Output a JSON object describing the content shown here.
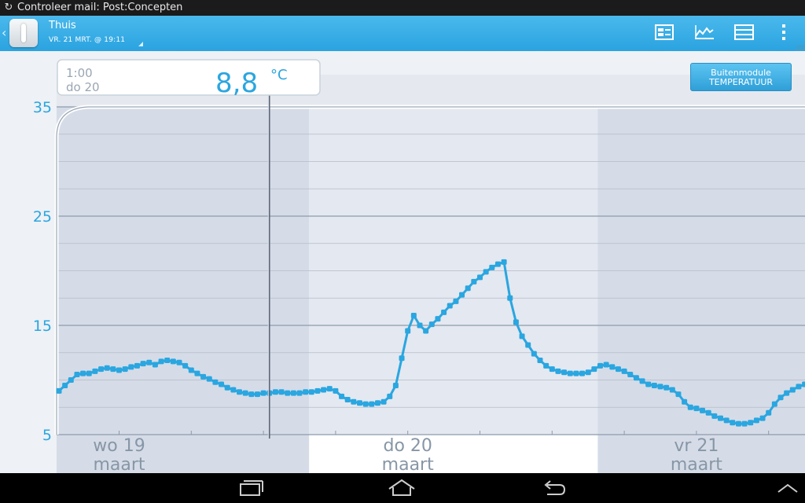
{
  "status_bar": {
    "notification": "Controleer mail: Post:Concepten"
  },
  "action_bar": {
    "location": "Thuis",
    "datetime": "VR. 21 MRT. @ 19:11",
    "icons": [
      "dashboard-icon",
      "graph-icon",
      "list-icon",
      "overflow-menu-icon"
    ]
  },
  "sensor_button": {
    "line1": "Buitenmodule",
    "line2": "TEMPERATUUR"
  },
  "readout": {
    "time": "1:00",
    "day": "do 20",
    "value": "8,8",
    "unit": "°C"
  },
  "colors": {
    "accent": "#2aa6e0",
    "line": "#2aa6e0",
    "shade": "#d5dce7",
    "plot": "#e4e8f0"
  },
  "chart_data": {
    "type": "line",
    "title": "",
    "xlabel": "",
    "ylabel": "",
    "ylim": [
      5,
      35
    ],
    "yticks": [
      5,
      15,
      25,
      35
    ],
    "x_range_hours": [
      0,
      68
    ],
    "day_labels": [
      {
        "day": "wo 19",
        "month": "maart",
        "hour": 5
      },
      {
        "day": "do 20",
        "month": "maart",
        "hour": 29
      },
      {
        "day": "vr 21",
        "month": "maart",
        "hour": 53
      }
    ],
    "cursor_hour": 17.5,
    "series": [
      {
        "points": [
          [
            0,
            9.0
          ],
          [
            0.5,
            9.5
          ],
          [
            1,
            10.0
          ],
          [
            1.5,
            10.5
          ],
          [
            2,
            10.6
          ],
          [
            2.5,
            10.6
          ],
          [
            3,
            10.8
          ],
          [
            3.5,
            11.0
          ],
          [
            4,
            11.1
          ],
          [
            4.5,
            11.0
          ],
          [
            5,
            10.9
          ],
          [
            5.5,
            11.0
          ],
          [
            6,
            11.2
          ],
          [
            6.5,
            11.3
          ],
          [
            7,
            11.5
          ],
          [
            7.5,
            11.6
          ],
          [
            8,
            11.4
          ],
          [
            8.5,
            11.7
          ],
          [
            9,
            11.8
          ],
          [
            9.5,
            11.7
          ],
          [
            10,
            11.6
          ],
          [
            10.5,
            11.3
          ],
          [
            11,
            10.9
          ],
          [
            11.5,
            10.6
          ],
          [
            12,
            10.3
          ],
          [
            12.5,
            10.1
          ],
          [
            13,
            9.8
          ],
          [
            13.5,
            9.6
          ],
          [
            14,
            9.3
          ],
          [
            14.5,
            9.1
          ],
          [
            15,
            8.9
          ],
          [
            15.5,
            8.8
          ],
          [
            16,
            8.7
          ],
          [
            16.5,
            8.7
          ],
          [
            17,
            8.8
          ],
          [
            17.5,
            8.8
          ],
          [
            18,
            8.9
          ],
          [
            18.5,
            8.9
          ],
          [
            19,
            8.8
          ],
          [
            19.5,
            8.8
          ],
          [
            20,
            8.8
          ],
          [
            20.5,
            8.9
          ],
          [
            21,
            8.9
          ],
          [
            21.5,
            9.0
          ],
          [
            22,
            9.1
          ],
          [
            22.5,
            9.2
          ],
          [
            23,
            9.0
          ],
          [
            23.5,
            8.5
          ],
          [
            24,
            8.2
          ],
          [
            24.5,
            8.0
          ],
          [
            25,
            7.9
          ],
          [
            25.5,
            7.8
          ],
          [
            26,
            7.8
          ],
          [
            26.5,
            7.9
          ],
          [
            27,
            8.0
          ],
          [
            27.5,
            8.5
          ],
          [
            28,
            9.5
          ],
          [
            28.5,
            12.0
          ],
          [
            29,
            14.5
          ],
          [
            29.5,
            15.9
          ],
          [
            30,
            15.0
          ],
          [
            30.5,
            14.5
          ],
          [
            31,
            15.1
          ],
          [
            31.5,
            15.6
          ],
          [
            32,
            16.2
          ],
          [
            32.5,
            16.8
          ],
          [
            33,
            17.2
          ],
          [
            33.5,
            17.8
          ],
          [
            34,
            18.4
          ],
          [
            34.5,
            19.0
          ],
          [
            35,
            19.4
          ],
          [
            35.5,
            19.9
          ],
          [
            36,
            20.3
          ],
          [
            36.5,
            20.6
          ],
          [
            37,
            20.8
          ],
          [
            37.5,
            17.5
          ],
          [
            38,
            15.3
          ],
          [
            38.5,
            14.0
          ],
          [
            39,
            13.2
          ],
          [
            39.5,
            12.4
          ],
          [
            40,
            11.8
          ],
          [
            40.5,
            11.3
          ],
          [
            41,
            11.0
          ],
          [
            41.5,
            10.8
          ],
          [
            42,
            10.7
          ],
          [
            42.5,
            10.6
          ],
          [
            43,
            10.6
          ],
          [
            43.5,
            10.6
          ],
          [
            44,
            10.7
          ],
          [
            44.5,
            11.0
          ],
          [
            45,
            11.3
          ],
          [
            45.5,
            11.4
          ],
          [
            46,
            11.2
          ],
          [
            46.5,
            11.0
          ],
          [
            47,
            10.8
          ],
          [
            47.5,
            10.5
          ],
          [
            48,
            10.2
          ],
          [
            48.5,
            9.9
          ],
          [
            49,
            9.6
          ],
          [
            49.5,
            9.5
          ],
          [
            50,
            9.4
          ],
          [
            50.5,
            9.3
          ],
          [
            51,
            9.1
          ],
          [
            51.5,
            8.7
          ],
          [
            52,
            8.0
          ],
          [
            52.5,
            7.5
          ],
          [
            53,
            7.4
          ],
          [
            53.5,
            7.2
          ],
          [
            54,
            7.0
          ],
          [
            54.5,
            6.7
          ],
          [
            55,
            6.5
          ],
          [
            55.5,
            6.3
          ],
          [
            56,
            6.1
          ],
          [
            56.5,
            6.0
          ],
          [
            57,
            6.0
          ],
          [
            57.5,
            6.1
          ],
          [
            58,
            6.3
          ],
          [
            58.5,
            6.5
          ],
          [
            59,
            7.0
          ],
          [
            59.5,
            7.8
          ],
          [
            60,
            8.4
          ],
          [
            60.5,
            8.8
          ],
          [
            61,
            9.1
          ],
          [
            61.5,
            9.4
          ],
          [
            62,
            9.6
          ],
          [
            62.5,
            9.7
          ],
          [
            63,
            9.7
          ],
          [
            63.5,
            9.6
          ],
          [
            64,
            9.3
          ],
          [
            64.5,
            8.8
          ],
          [
            65,
            8.5
          ]
        ]
      }
    ]
  }
}
